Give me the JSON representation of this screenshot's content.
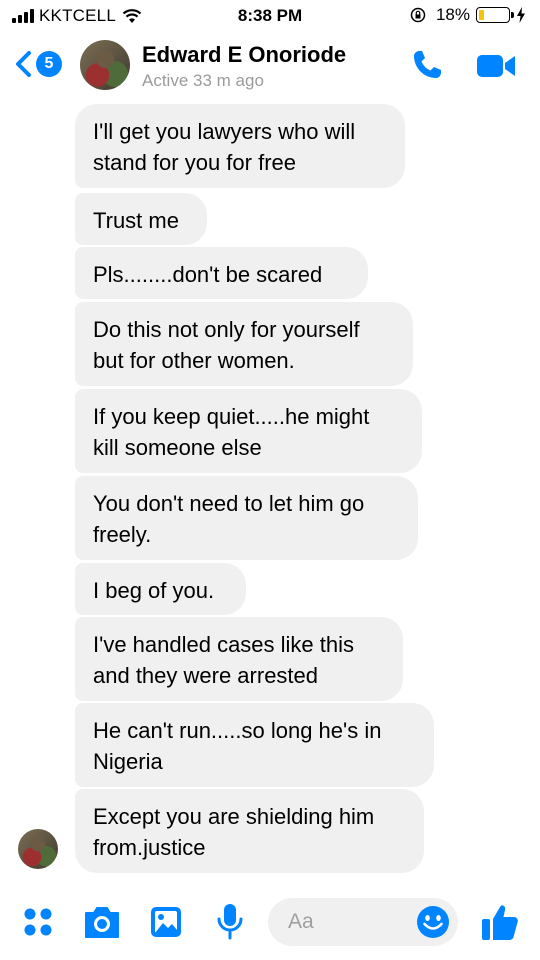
{
  "status_bar": {
    "carrier": "KKTCELL",
    "time": "8:38 PM",
    "battery_percent": "18%",
    "battery_level": 0.18,
    "battery_color": "#f4c30b"
  },
  "header": {
    "back_badge_count": "5",
    "contact_name": "Edward E Onoriode",
    "contact_status": "Active 33 m ago"
  },
  "messages": [
    {
      "text": "I'll get you lawyers who will\nstand for you for free"
    },
    {
      "text": "Trust me"
    },
    {
      "text": "Pls........don't be scared"
    },
    {
      "text": "Do this not only for yourself\nbut for other women."
    },
    {
      "text": "If you keep quiet.....he might\nkill someone else"
    },
    {
      "text": "You don't need to let him go\nfreely."
    },
    {
      "text": "I beg of you."
    },
    {
      "text": "I've handled cases like this\nand they were arrested"
    },
    {
      "text": "He can't run.....so long he's in\nNigeria"
    },
    {
      "text": "Except you are shielding him\nfrom.justice"
    }
  ],
  "composer": {
    "placeholder": "Aa"
  },
  "colors": {
    "accent": "#0084ff",
    "bubble": "#f1f0f0"
  },
  "icons": [
    "signal-bars-icon",
    "wifi-icon",
    "orientation-lock-icon",
    "battery-icon",
    "charging-bolt-icon",
    "back-chevron-icon",
    "phone-icon",
    "video-camera-icon",
    "apps-grid-icon",
    "camera-icon",
    "photo-gallery-icon",
    "microphone-icon",
    "emoji-icon",
    "thumbs-up-icon"
  ]
}
